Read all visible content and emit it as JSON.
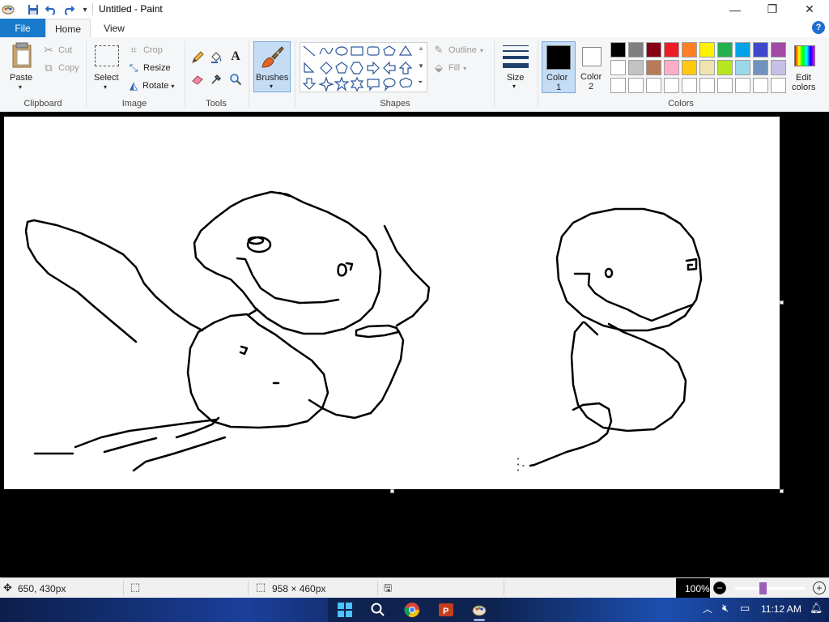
{
  "window": {
    "title": "Untitled - Paint",
    "controls": {
      "minimize": "—",
      "maximize": "❐",
      "close": "✕"
    }
  },
  "tabs": {
    "file": "File",
    "home": "Home",
    "view": "View"
  },
  "help_label": "?",
  "ribbon": {
    "clipboard": {
      "label": "Clipboard",
      "paste": "Paste",
      "cut": "Cut",
      "copy": "Copy"
    },
    "image": {
      "label": "Image",
      "select": "Select",
      "crop": "Crop",
      "resize": "Resize",
      "rotate": "Rotate"
    },
    "tools": {
      "label": "Tools"
    },
    "brushes": {
      "label": "Brushes"
    },
    "shapes": {
      "label": "Shapes",
      "outline": "Outline",
      "fill": "Fill"
    },
    "size": {
      "label": "Size"
    },
    "color1": {
      "line1": "Color",
      "line2": "1",
      "value": "#000000"
    },
    "color2": {
      "line1": "Color",
      "line2": "2",
      "value": "#ffffff"
    },
    "colors": {
      "label": "Colors",
      "row1": [
        "#000000",
        "#7f7f7f",
        "#880015",
        "#ed1c24",
        "#ff7f27",
        "#fff200",
        "#22b14c",
        "#00a2e8",
        "#3f48cc",
        "#a349a4"
      ],
      "row2": [
        "#ffffff",
        "#c3c3c3",
        "#b97a57",
        "#ffaec9",
        "#ffc90e",
        "#efe4b0",
        "#b5e61d",
        "#99d9ea",
        "#7092be",
        "#c8bfe7"
      ],
      "row3": [
        "#ffffff",
        "#ffffff",
        "#ffffff",
        "#ffffff",
        "#ffffff",
        "#ffffff",
        "#ffffff",
        "#ffffff",
        "#ffffff",
        "#ffffff"
      ]
    },
    "edit_colors": {
      "line1": "Edit",
      "line2": "colors"
    }
  },
  "status": {
    "cursor_pos": "650, 430px",
    "canvas_size": "958 × 460px",
    "zoom": "100%",
    "zoom_fraction": 0.4
  },
  "taskbar": {
    "time": "11:12 AM"
  }
}
